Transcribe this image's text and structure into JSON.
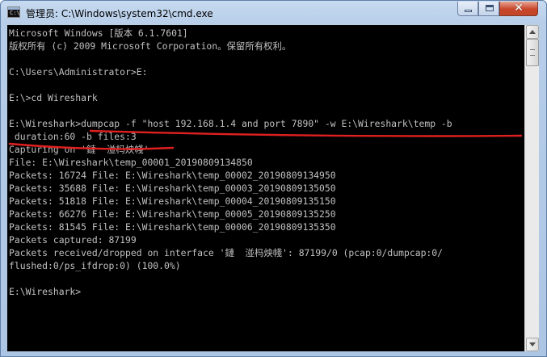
{
  "window": {
    "title": "管理员: C:\\Windows\\system32\\cmd.exe",
    "icon": "cmd-icon",
    "controls": {
      "minimize": "minimize-icon",
      "maximize": "maximize-icon",
      "close": "✕"
    }
  },
  "console": {
    "lines": [
      "Microsoft Windows [版本 6.1.7601]",
      "版权所有 (c) 2009 Microsoft Corporation。保留所有权利。",
      "",
      "C:\\Users\\Administrator>E:",
      "",
      "E:\\>cd Wireshark",
      "",
      "E:\\Wireshark>dumpcap -f \"host 192.168.1.4 and port 7890\" -w E:\\Wireshark\\temp -b",
      " duration:60 -b files:3",
      "Capturing on '鏈  湴杩炴帴'",
      "File: E:\\Wireshark\\temp_00001_20190809134850",
      "Packets: 16724 File: E:\\Wireshark\\temp_00002_20190809134950",
      "Packets: 35688 File: E:\\Wireshark\\temp_00003_20190809135050",
      "Packets: 51818 File: E:\\Wireshark\\temp_00004_20190809135150",
      "Packets: 66276 File: E:\\Wireshark\\temp_00005_20190809135250",
      "Packets: 81545 File: E:\\Wireshark\\temp_00006_20190809135350",
      "Packets captured: 87199",
      "Packets received/dropped on interface '鏈  湴杩炴帴': 87199/0 (pcap:0/dumpcap:0/",
      "flushed:0/ps_ifdrop:0) (100.0%)",
      "",
      "E:\\Wireshark>"
    ]
  },
  "annotation": {
    "color": "#e02020"
  },
  "colors": {
    "console_bg": "#000000",
    "console_fg": "#c0c0c0"
  }
}
